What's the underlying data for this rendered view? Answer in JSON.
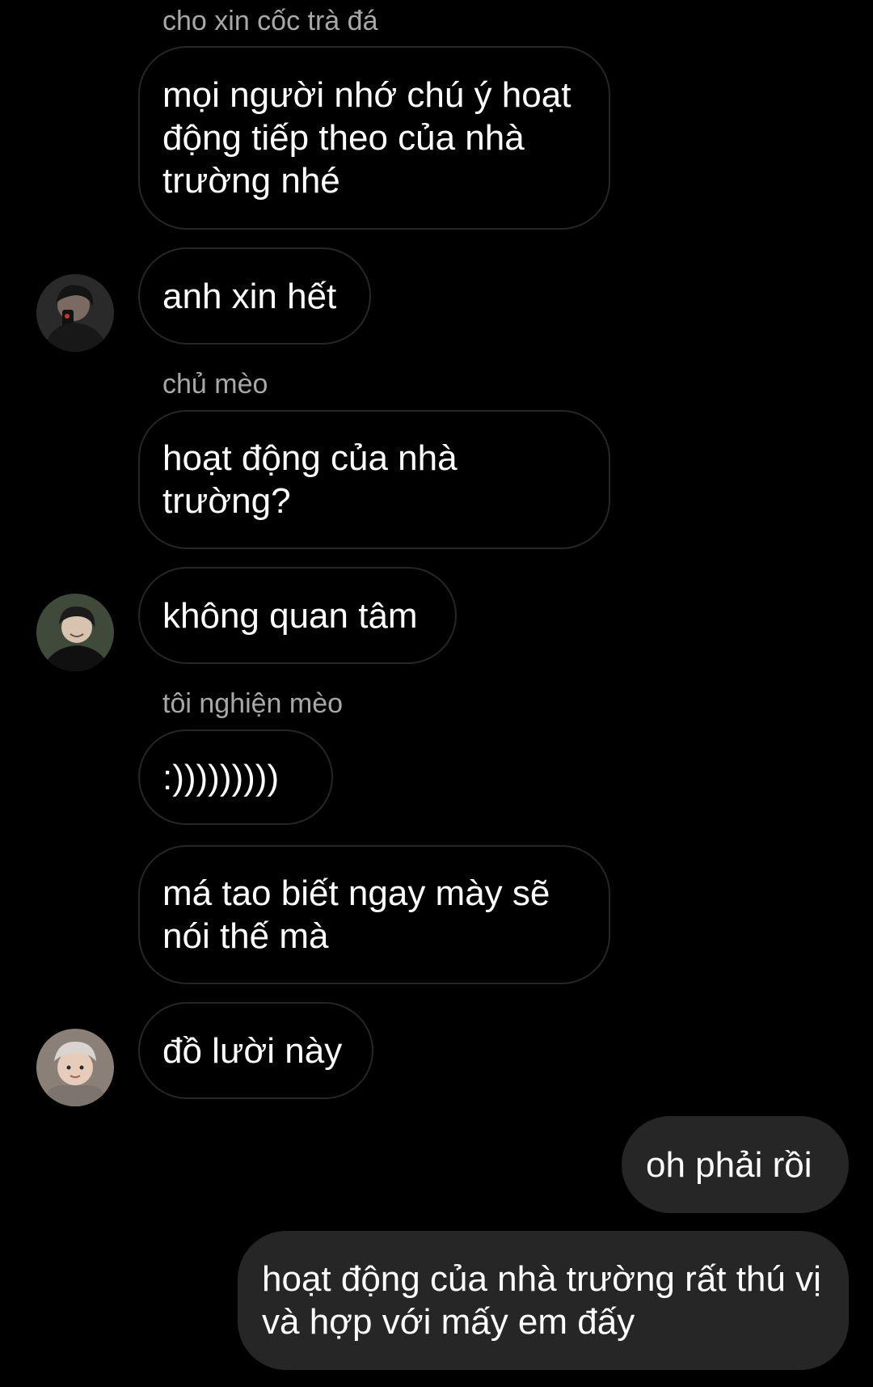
{
  "messages": [
    {
      "sender_name": "cho xin cốc trà đá",
      "text": "mọi người nhớ chú ý hoạt động tiếp theo của nhà trường nhé"
    },
    {
      "text": "anh xin hết",
      "avatar_icon": "user-avatar-icon"
    },
    {
      "sender_name": "chủ mèo",
      "text": "hoạt động của nhà trường?"
    },
    {
      "text": "không quan tâm",
      "avatar_icon": "user-avatar-icon"
    },
    {
      "sender_name": "tôi nghiện mèo",
      "text": ":)))))))))"
    },
    {
      "text": "má tao biết ngay mày sẽ nói thế mà"
    },
    {
      "text": "đồ lười này",
      "avatar_icon": "user-avatar-icon"
    },
    {
      "text": "oh phải rồi",
      "outgoing": true
    },
    {
      "text": "hoạt động của nhà trường rất thú vị và hợp với mấy em đấy",
      "outgoing": true
    }
  ],
  "colors": {
    "background": "#000000",
    "incoming_border": "#262626",
    "outgoing_bubble": "#262626",
    "sender_name": "#a8a8a8",
    "text": "#ffffff"
  }
}
